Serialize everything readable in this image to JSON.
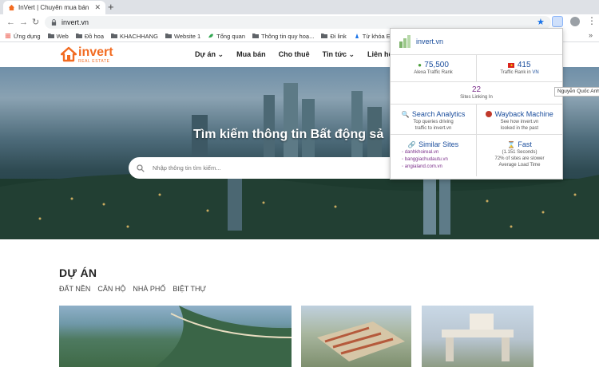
{
  "browser": {
    "tab_title": "InVert | Chuyên mua bán Bất Đ",
    "url": "invert.vn",
    "bookmarks": [
      "Ứng dụng",
      "Web",
      "Đồ hoạ",
      "KHACHHANG",
      "Website 1",
      "Tổng quan",
      "Thông tin quy hoạ...",
      "Đi link",
      "Từ khóa Explorer"
    ],
    "tooltip": "Nguyễn Quốc Anh"
  },
  "site": {
    "logo_name": "invert",
    "logo_sub": "REAL ESTATE",
    "nav": [
      "Dự án",
      "Mua bán",
      "Cho thuê",
      "Tin tức",
      "Liên hệ"
    ],
    "hero_title": "Tìm kiếm thông tin Bất động sả",
    "search_placeholder": "Nhập thông tin tìm kiếm...",
    "section_title": "DỰ ÁN",
    "filters": [
      "ĐẤT NỀN",
      "CĂN HỘ",
      "NHÀ PHỐ",
      "BIỆT THỰ"
    ]
  },
  "popup": {
    "site": "invert.vn",
    "alexa_rank": "75,500",
    "alexa_label": "Alexa Traffic Rank",
    "country_rank": "415",
    "country_label_prefix": "Traffic Rank in",
    "country_code": "VN",
    "links": "22",
    "links_label": "Sites Linking In",
    "analytics_title": "Search Analytics",
    "analytics_desc1": "Top queries driving",
    "analytics_desc2": "traffic to invert.vn",
    "wayback_title": "Wayback Machine",
    "wayback_desc1": "See how invert.vn",
    "wayback_desc2": "looked in the past",
    "similar_title": "Similar Sites",
    "similar_sites": [
      "danhkhoireal.vn",
      "banggiachudautu.vn",
      "angialand.com.vn"
    ],
    "speed_title": "Fast",
    "speed_seconds": "(1.151 Seconds)",
    "speed_compare": "72% of sites are slower",
    "speed_label": "Average Load Time"
  }
}
